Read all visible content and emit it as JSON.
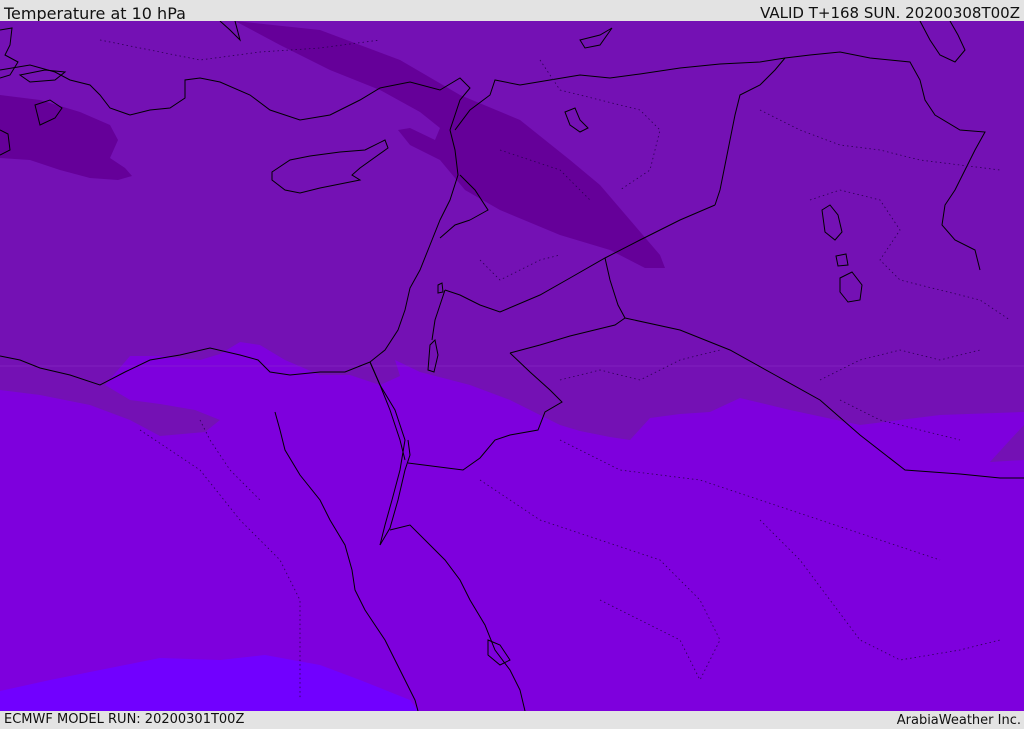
{
  "header": {
    "title": "Temperature at 10 hPa",
    "valid_time": "VALID T+168 SUN. 20200308T00Z"
  },
  "footer": {
    "model_run": "ECMWF MODEL RUN: 20200301T00Z",
    "credit": "ArabiaWeather Inc."
  },
  "map": {
    "shading_colors": {
      "darkest": "#650099",
      "dark": "#7411b4",
      "mid": "#7e00dd",
      "light": "#7100ff"
    },
    "coastline_color": "#000000",
    "border_color": "#000000",
    "province_line_style": "dotted"
  }
}
